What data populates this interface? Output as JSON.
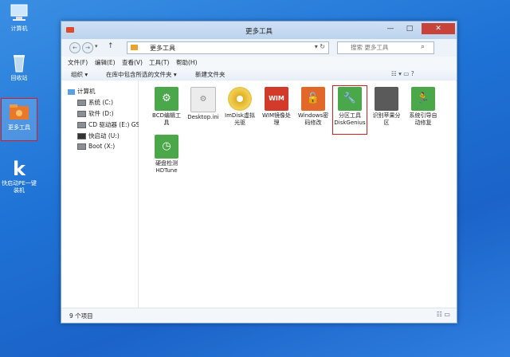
{
  "desktop": {
    "icons": [
      {
        "label": "计算机"
      },
      {
        "label": "回收站"
      },
      {
        "label": "更多工具"
      },
      {
        "label": "快启动PE一键装机"
      }
    ]
  },
  "window": {
    "title": "更多工具",
    "controls": {
      "minimize": "—",
      "maximize": "□",
      "close": "✕"
    },
    "nav": {
      "back": "←",
      "forward": "→",
      "dropdown": "▾",
      "up": "↑"
    },
    "address": {
      "path": "更多工具",
      "arrows": "▾ ↻"
    },
    "search": {
      "placeholder": "搜索 更多工具"
    },
    "menu": [
      "文件(F)",
      "编辑(E)",
      "查看(V)",
      "工具(T)",
      "帮助(H)"
    ],
    "toolbar": {
      "organize": "组织 ▾",
      "include_in_library": "在库中包含所选的文件夹 ▾",
      "new_folder": "新建文件夹",
      "view_icons": "☷ ▾ ▭ ?"
    },
    "sidebar": {
      "root": "计算机",
      "drives": [
        "系统 (C:)",
        "软件 (D:)",
        "CD 驱动器 (E:) GSP",
        "快启动 (U:)",
        "Boot (X:)"
      ]
    },
    "files": [
      {
        "name": "BCD编辑工具",
        "icon": "gear-icon",
        "color": "#4aa84a"
      },
      {
        "name": "Desktop.ini",
        "icon": "ini-file-icon",
        "color": "#e6e6e6"
      },
      {
        "name": "ImDisk虚拟光驱",
        "icon": "disc-icon",
        "color": "#e0b020"
      },
      {
        "name": "WIM镜像处理",
        "icon": "wim-icon",
        "color": "#d23a2a"
      },
      {
        "name": "Windows密码修改",
        "icon": "lock-icon",
        "color": "#e2672a"
      },
      {
        "name": "分区工具DiskGenius",
        "icon": "wrench-icon",
        "color": "#4aa84a"
      },
      {
        "name": "识别苹果分区",
        "icon": "apple-icon",
        "color": "#5a5a5a"
      },
      {
        "name": "系统引导自动修复",
        "icon": "runner-icon",
        "color": "#4aa84a"
      },
      {
        "name": "硬盘检测HDTune",
        "icon": "clock-icon",
        "color": "#4aa84a"
      }
    ],
    "status": {
      "count": "9 个项目",
      "view": "☷ ▭"
    }
  },
  "colors": {
    "desktop": "#1f73d6",
    "highlight": "#d61e1e"
  }
}
